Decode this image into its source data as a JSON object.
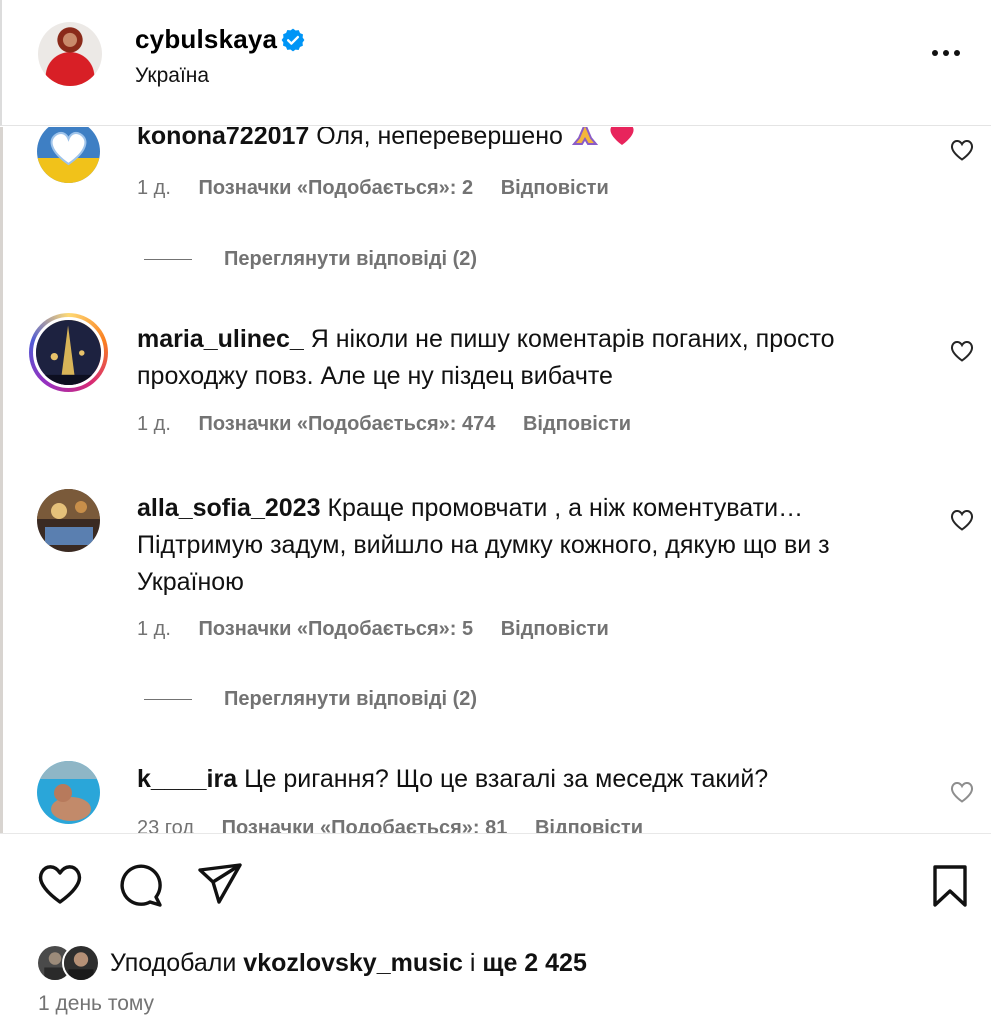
{
  "header": {
    "username": "cybulskaya",
    "location": "Україна",
    "verified_icon": "verified-badge-icon",
    "more_icon": "more-options-icon"
  },
  "comments": [
    {
      "username": "konona722017",
      "text": "Оля, неперевершено",
      "emojis": [
        "praying-hands-emoji",
        "heart-emoji"
      ],
      "time": "1 д.",
      "likes": "Позначки «Подобається»: 2",
      "reply": "Відповісти",
      "view_replies": "Переглянути відповіді (2)"
    },
    {
      "username": "maria_ulinec_",
      "text": "Я ніколи не пишу коментарів поганих, просто проходжу повз. Але це ну піздец вибачте",
      "time": "1 д.",
      "likes": "Позначки «Подобається»: 474",
      "reply": "Відповісти"
    },
    {
      "username": "alla_sofia_2023",
      "text": "Краще промовчати , а ніж коментувати… Підтримую задум, вийшло на думку кожного, дякую що ви з Україною",
      "time": "1 д.",
      "likes": "Позначки «Подобається»: 5",
      "reply": "Відповісти",
      "view_replies": "Переглянути відповіді (2)"
    },
    {
      "username": "k____ira",
      "text": "Це ригання? Що це взагалі за меседж такий?",
      "time": "23 год",
      "likes": "Позначки «Подобається»: 81",
      "reply": "Відповісти"
    }
  ],
  "likes_summary": {
    "prefix": "Уподобали",
    "user": "vkozlovsky_music",
    "and": "і",
    "more": "ще 2 425"
  },
  "posted": "1 день тому",
  "colors": {
    "text": "#000000",
    "secondary": "#737373",
    "verified": "#0095f6",
    "heart_emoji": "#e8245c"
  }
}
